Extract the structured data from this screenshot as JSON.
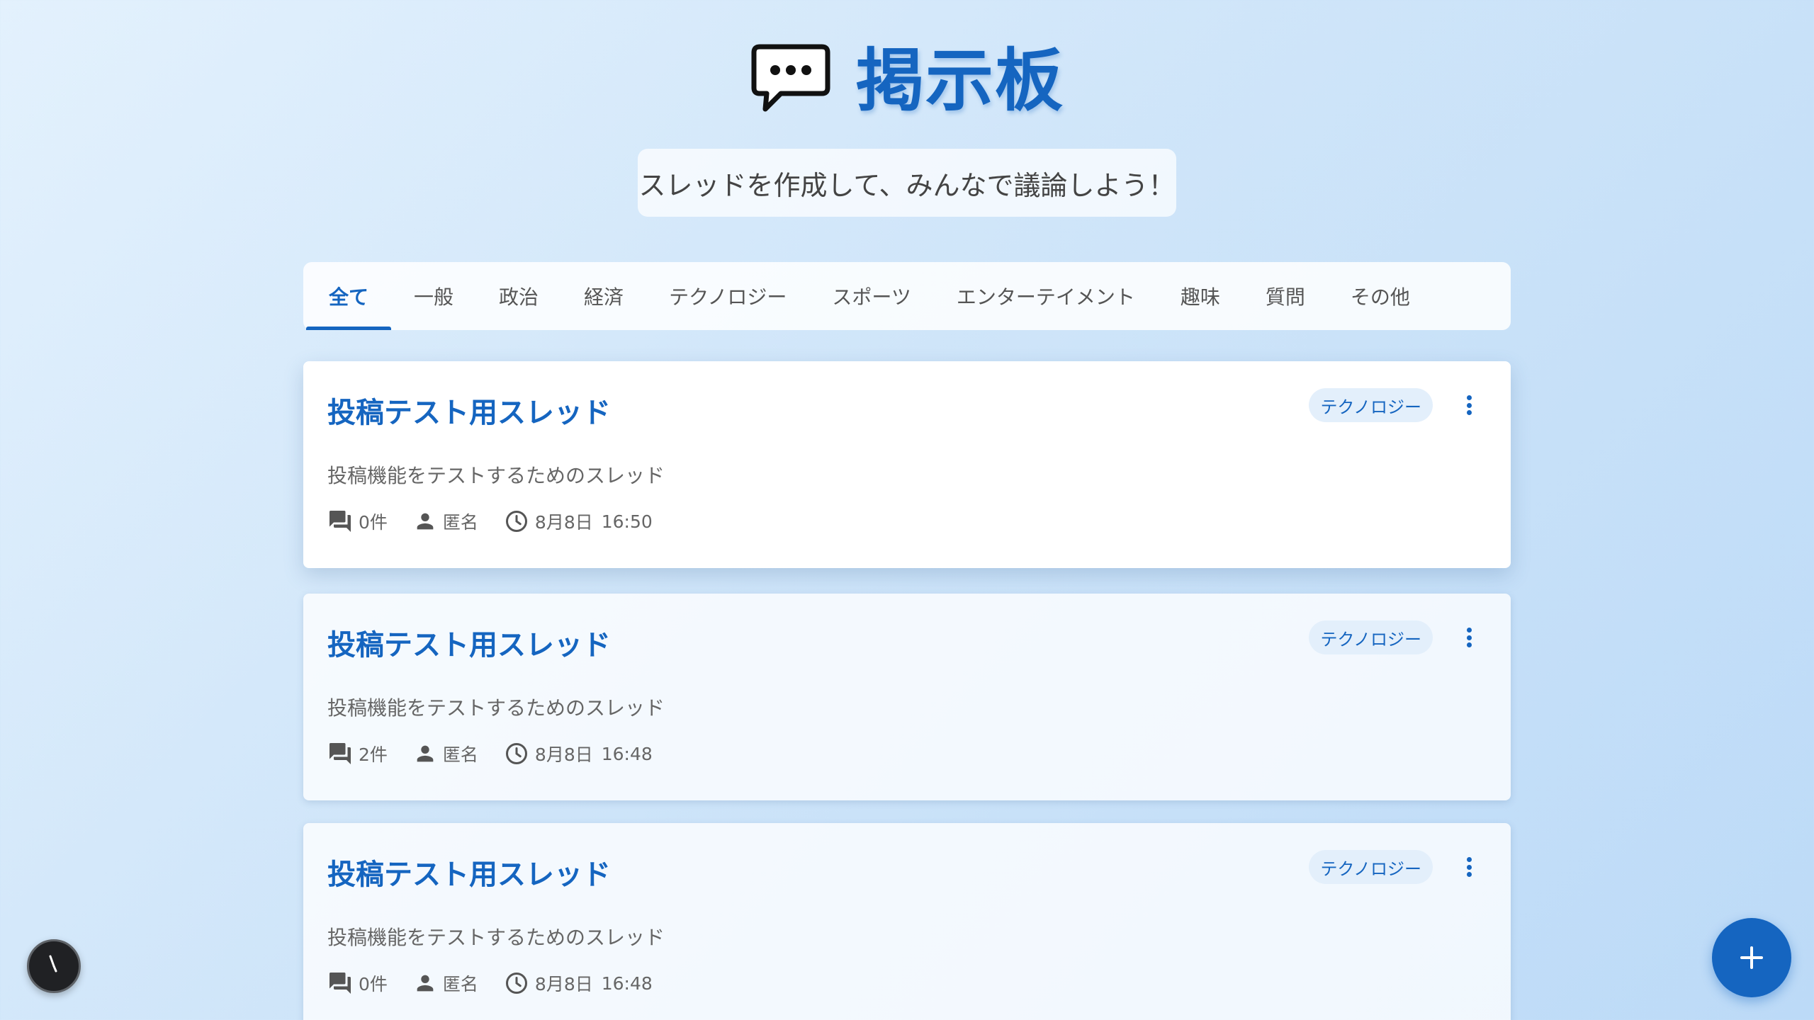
{
  "header": {
    "title": "掲示板",
    "subtitle": "スレッドを作成して、みんなで議論しよう！"
  },
  "tabs": [
    {
      "label": "全て",
      "active": true
    },
    {
      "label": "一般",
      "active": false
    },
    {
      "label": "政治",
      "active": false
    },
    {
      "label": "経済",
      "active": false
    },
    {
      "label": "テクノロジー",
      "active": false
    },
    {
      "label": "スポーツ",
      "active": false
    },
    {
      "label": "エンターテイメント",
      "active": false
    },
    {
      "label": "趣味",
      "active": false
    },
    {
      "label": "質問",
      "active": false
    },
    {
      "label": "その他",
      "active": false
    }
  ],
  "threads": [
    {
      "title": "投稿テスト用スレッド",
      "category": "テクノロジー",
      "description": "投稿機能をテストするためのスレッド",
      "replies": "0件",
      "author": "匿名",
      "date": "8月8日",
      "time": "16:50"
    },
    {
      "title": "投稿テスト用スレッド",
      "category": "テクノロジー",
      "description": "投稿機能をテストするためのスレッド",
      "replies": "2件",
      "author": "匿名",
      "date": "8月8日",
      "time": "16:48"
    },
    {
      "title": "投稿テスト用スレッド",
      "category": "テクノロジー",
      "description": "投稿機能をテストするためのスレッド",
      "replies": "0件",
      "author": "匿名",
      "date": "8月8日",
      "time": "16:48"
    }
  ],
  "icons": {
    "logo": "speech-bubble-icon",
    "replies": "forum-icon",
    "author": "person-icon",
    "time": "clock-icon",
    "menu": "more-vert-icon",
    "fab": "plus-icon"
  },
  "colors": {
    "accent": "#1565c0",
    "badge_bg": "#e3effb"
  }
}
